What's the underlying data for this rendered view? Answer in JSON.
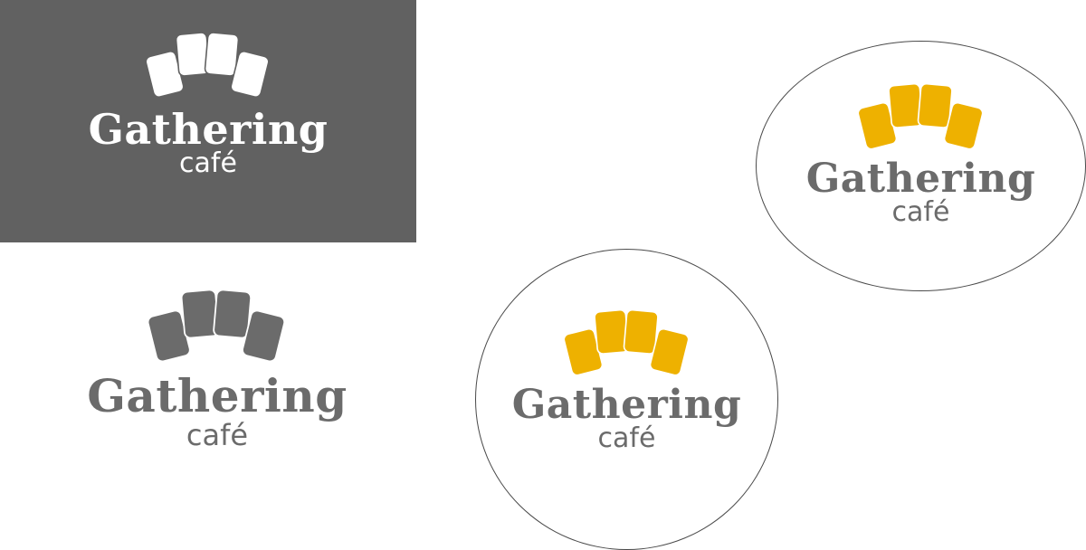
{
  "logos": [
    {
      "id": "dark",
      "name": "Gathering",
      "tagline": "café",
      "card_color": "#ffffff",
      "outline_color": "#616161",
      "text_color": "#ffffff",
      "background": "#616161"
    },
    {
      "id": "plain",
      "name": "Gathering",
      "tagline": "café",
      "card_color": "#6b6b6b",
      "outline_color": "#ffffff",
      "text_color": "#6b6b6b",
      "background": "#ffffff"
    },
    {
      "id": "circle",
      "name": "Gathering",
      "tagline": "café",
      "card_color": "#eeb100",
      "outline_color": "#ffffff",
      "text_color": "#6b6b6b",
      "background": "#ffffff"
    },
    {
      "id": "oval",
      "name": "Gathering",
      "tagline": "café",
      "card_color": "#eeb100",
      "outline_color": "#ffffff",
      "text_color": "#6b6b6b",
      "background": "#ffffff"
    }
  ],
  "icon": "fanned-cards-icon"
}
